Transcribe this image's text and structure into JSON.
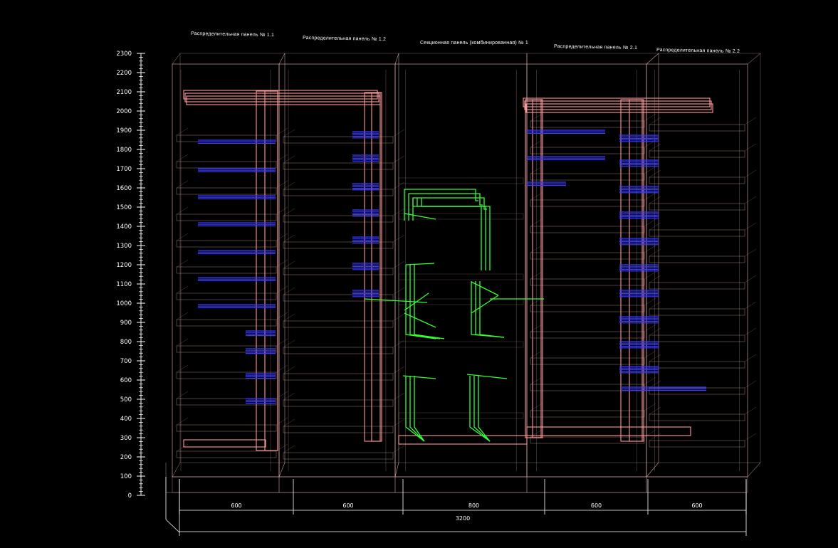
{
  "panel_titles": [
    "Распределительная панель № 1.1",
    "Распределительная панель № 1.2",
    "Секционная панель (комбинированная) № 1",
    "Распределительная панель № 2.1",
    "Распределительная панель № 2.2"
  ],
  "height_scale": {
    "ticks": [
      "0",
      "100",
      "200",
      "300",
      "400",
      "500",
      "600",
      "700",
      "800",
      "900",
      "1000",
      "1100",
      "1200",
      "1300",
      "1400",
      "1500",
      "1600",
      "1700",
      "1800",
      "1900",
      "2000",
      "2100",
      "2200",
      "2300"
    ]
  },
  "width_dimensions": [
    "600",
    "600",
    "800",
    "600",
    "600"
  ],
  "total_width": "3200",
  "colors": {
    "background": "#000000",
    "frame": "#d8a8a8",
    "busbar_main": "#ff9a9a",
    "busbar_distribution": "#3a3aff",
    "busbar_section": "#33ff33",
    "dimension": "#ffffff"
  }
}
